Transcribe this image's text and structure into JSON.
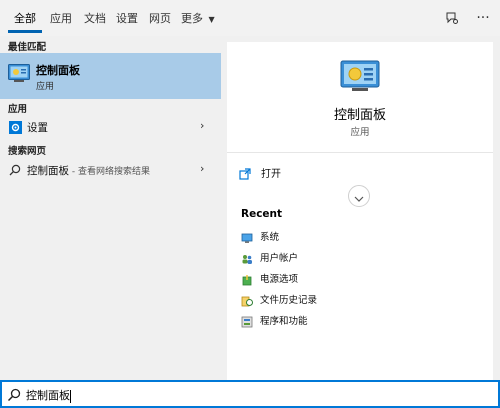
{
  "tabs": [
    {
      "label": "全部"
    },
    {
      "label": "应用"
    },
    {
      "label": "文档"
    },
    {
      "label": "设置"
    },
    {
      "label": "网页"
    },
    {
      "label": "更多"
    }
  ],
  "top_icons": [
    "feedback-icon",
    "more-options-icon"
  ],
  "left": {
    "best_match_heading": "最佳匹配",
    "best_match": {
      "title": "控制面板",
      "subtitle": "应用",
      "icon": "control-panel-icon"
    },
    "apps_heading": "应用",
    "apps": [
      {
        "label": "设置",
        "icon": "gear-icon"
      }
    ],
    "web_heading": "搜索网页",
    "web": [
      {
        "label": "控制面板",
        "sub": " - 查看网络搜索结果",
        "icon": "search-icon"
      }
    ]
  },
  "right": {
    "title": "控制面板",
    "type": "应用",
    "open_label": "打开",
    "recent_heading": "Recent",
    "recent": [
      {
        "label": "系统",
        "icon": "system-icon"
      },
      {
        "label": "用户帐户",
        "icon": "user-accounts-icon"
      },
      {
        "label": "电源选项",
        "icon": "power-options-icon"
      },
      {
        "label": "文件历史记录",
        "icon": "file-history-icon"
      },
      {
        "label": "程序和功能",
        "icon": "programs-icon"
      }
    ]
  },
  "search": {
    "value": "控制面板"
  },
  "colors": {
    "accent": "#0078d7",
    "selection": "#a8cbe8",
    "tab_underline": "#0063b1"
  }
}
